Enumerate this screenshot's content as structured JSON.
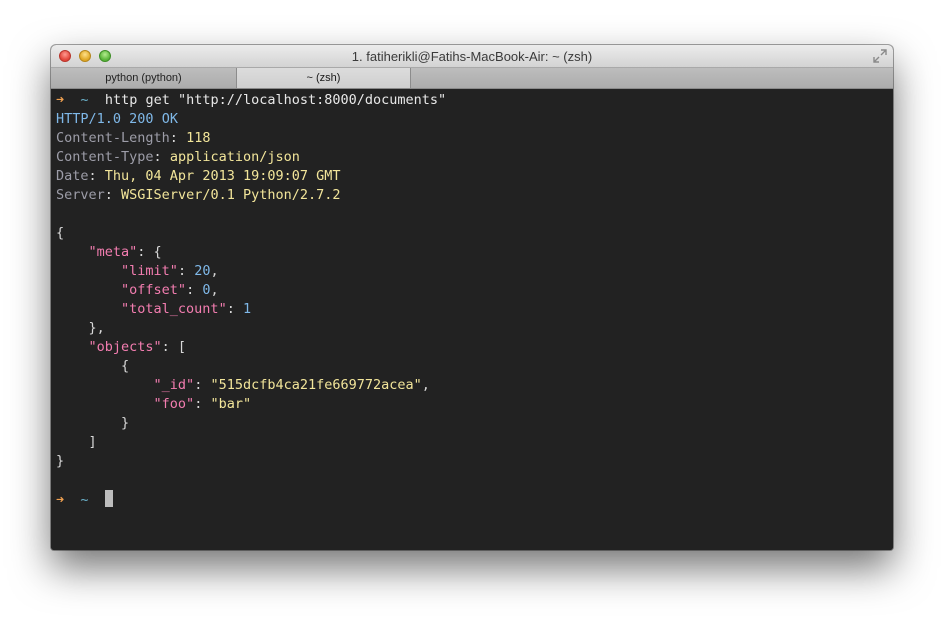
{
  "window": {
    "title": "1. fatiherikli@Fatihs-MacBook-Air: ~ (zsh)"
  },
  "tabs": [
    {
      "label": "python (python)"
    },
    {
      "label": "~ (zsh)"
    }
  ],
  "prompt": {
    "arrow": "➜",
    "dir": "~",
    "command": "http get \"http://localhost:8000/documents\""
  },
  "response": {
    "protocol": "HTTP/1.0",
    "status_code": "200",
    "status_text": "OK",
    "headers": [
      {
        "name": "Content-Length",
        "value": "118"
      },
      {
        "name": "Content-Type",
        "value": "application/json"
      },
      {
        "name": "Date",
        "value": "Thu, 04 Apr 2013 19:09:07 GMT"
      },
      {
        "name": "Server",
        "value": "WSGIServer/0.1 Python/2.7.2"
      }
    ]
  },
  "body": {
    "open_brace": "{",
    "meta_key": "\"meta\"",
    "meta_open": ": {",
    "limit_key": "\"limit\"",
    "limit_value": "20",
    "offset_key": "\"offset\"",
    "offset_value": "0",
    "total_key": "\"total_count\"",
    "total_value": "1",
    "meta_close": "},",
    "objects_key": "\"objects\"",
    "objects_open": ": [",
    "obj_open": "{",
    "id_key": "\"_id\"",
    "id_value": "\"515dcfb4ca21fe669772acea\"",
    "foo_key": "\"foo\"",
    "foo_value": "\"bar\"",
    "obj_close": "}",
    "objects_close": "]",
    "close_brace": "}"
  },
  "colors": {
    "background": "#222222",
    "arrow": "#f0a050",
    "key": "#f37db0",
    "string": "#f2e59a",
    "number": "#7fb8e8"
  }
}
